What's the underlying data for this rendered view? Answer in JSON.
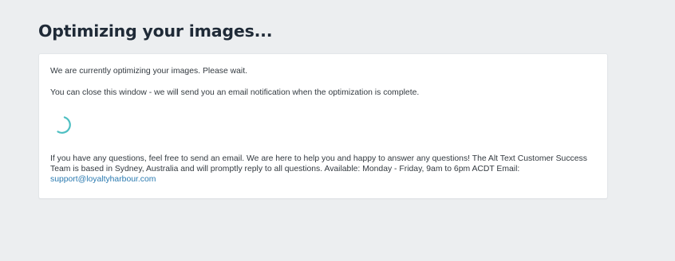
{
  "page": {
    "title": "Optimizing your images..."
  },
  "card": {
    "message_waiting": "We are currently optimizing your images. Please wait.",
    "message_close": "You can close this window - we will send you an email notification when the optimization is complete.",
    "help_text": "If you have any questions, feel free to send an email. We are here to help you and happy to answer any questions! The Alt Text Customer Success Team is based in Sydney, Australia and will promptly reply to all questions. Available: Monday - Friday, 9am to 6pm ACDT Email:",
    "support_email": "support@loyaltyharbour.com"
  },
  "spinner": {
    "icon": "loading-spinner-icon",
    "color": "#4ebfc2"
  },
  "colors": {
    "background": "#eceef0",
    "card": "#ffffff",
    "title": "#1f2a37",
    "text": "#333a40",
    "link": "#2a7ab0"
  }
}
